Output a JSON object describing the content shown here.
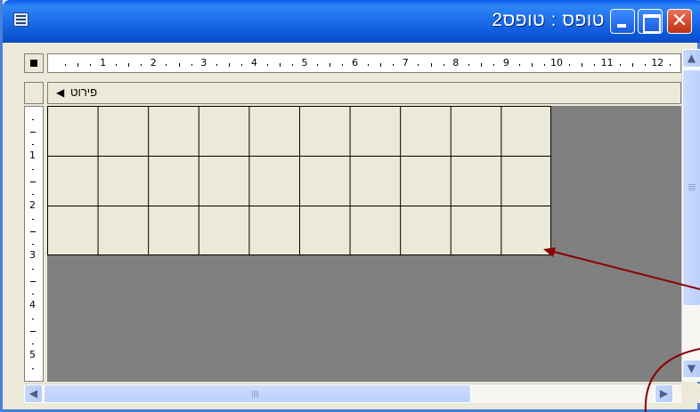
{
  "window": {
    "title": "טופס : טופס2",
    "icon": "form-icon",
    "close_glyph": "✕"
  },
  "ruler": {
    "horizontal_numbers": [
      "1",
      "2",
      "3",
      "4",
      "5",
      "6",
      "7",
      "8",
      "9",
      "10",
      "11",
      "12"
    ],
    "vertical_numbers": [
      "1",
      "2",
      "3",
      "4",
      "5"
    ]
  },
  "section": {
    "label": "פירוט",
    "arrow": "◀"
  },
  "scrollbars": {
    "up": "▲",
    "down": "▼",
    "left": "◀",
    "right": "▶"
  },
  "annotation": {
    "color": "#8b0000"
  },
  "colors": {
    "titlebar": "#0a5cea",
    "detail_grid": "#ece9d8",
    "canvas": "#808080"
  }
}
